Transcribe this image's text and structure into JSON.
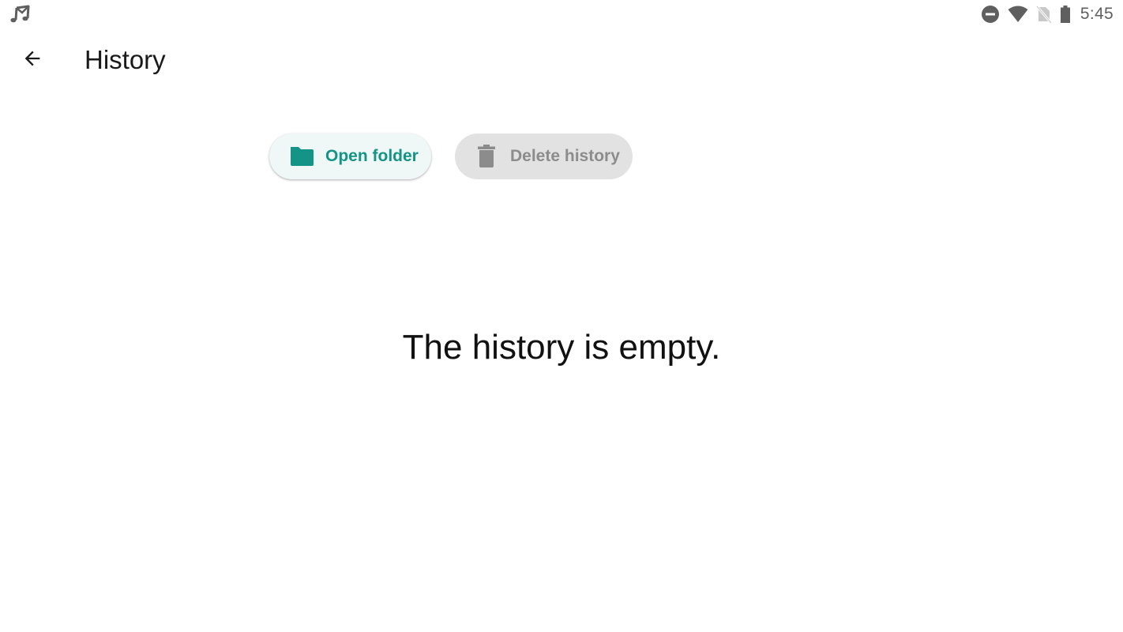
{
  "status_bar": {
    "left_icons": [
      "music-note-icon"
    ],
    "right_icons": [
      "do-not-disturb-icon",
      "wifi-icon",
      "no-sim-icon",
      "battery-icon"
    ],
    "time": "5:45"
  },
  "app_bar": {
    "back_icon": "arrow-back-icon",
    "title": "History"
  },
  "actions": {
    "open_folder": {
      "label": "Open folder",
      "icon": "folder-icon",
      "color": "#139486",
      "enabled": true
    },
    "delete_history": {
      "label": "Delete history",
      "icon": "trash-icon",
      "color": "#8c8c8c",
      "enabled": false
    }
  },
  "content": {
    "empty_message": "The history is empty."
  },
  "colors": {
    "accent": "#139486",
    "chip_active_bg": "#f0f8f7",
    "chip_disabled_bg": "#e2e2e2",
    "status_icon": "#5f5f5f"
  }
}
